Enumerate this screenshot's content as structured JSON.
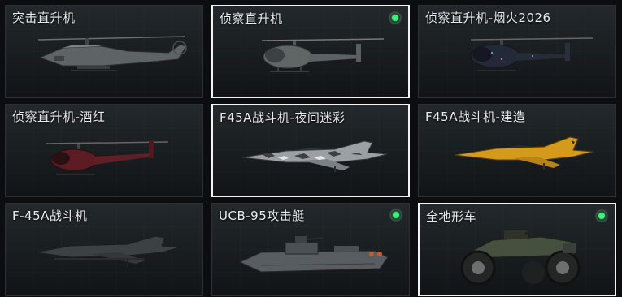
{
  "vehicles": [
    {
      "name": "突击直升机",
      "selected": false,
      "equipped": false,
      "icon": "attack-helicopter-icon"
    },
    {
      "name": "侦察直升机",
      "selected": true,
      "equipped": true,
      "icon": "scout-helicopter-icon"
    },
    {
      "name": "侦察直升机-烟火2026",
      "selected": false,
      "equipped": false,
      "icon": "scout-helicopter-icon"
    },
    {
      "name": "侦察直升机-酒红",
      "selected": false,
      "equipped": false,
      "icon": "scout-helicopter-icon"
    },
    {
      "name": "F45A战斗机-夜间迷彩",
      "selected": true,
      "equipped": false,
      "icon": "fighter-jet-icon"
    },
    {
      "name": "F45A战斗机-建造",
      "selected": false,
      "equipped": false,
      "icon": "fighter-jet-icon"
    },
    {
      "name": "F-45A战斗机",
      "selected": false,
      "equipped": false,
      "icon": "stealth-jet-icon"
    },
    {
      "name": "UCB-95攻击艇",
      "selected": false,
      "equipped": true,
      "icon": "attack-boat-icon"
    },
    {
      "name": "全地形车",
      "selected": true,
      "equipped": true,
      "icon": "atv-icon"
    }
  ],
  "colors": {
    "equipped_indicator": "#3cf07a",
    "selected_border": "#f2f2f2",
    "card_bg": "#1c2124"
  }
}
